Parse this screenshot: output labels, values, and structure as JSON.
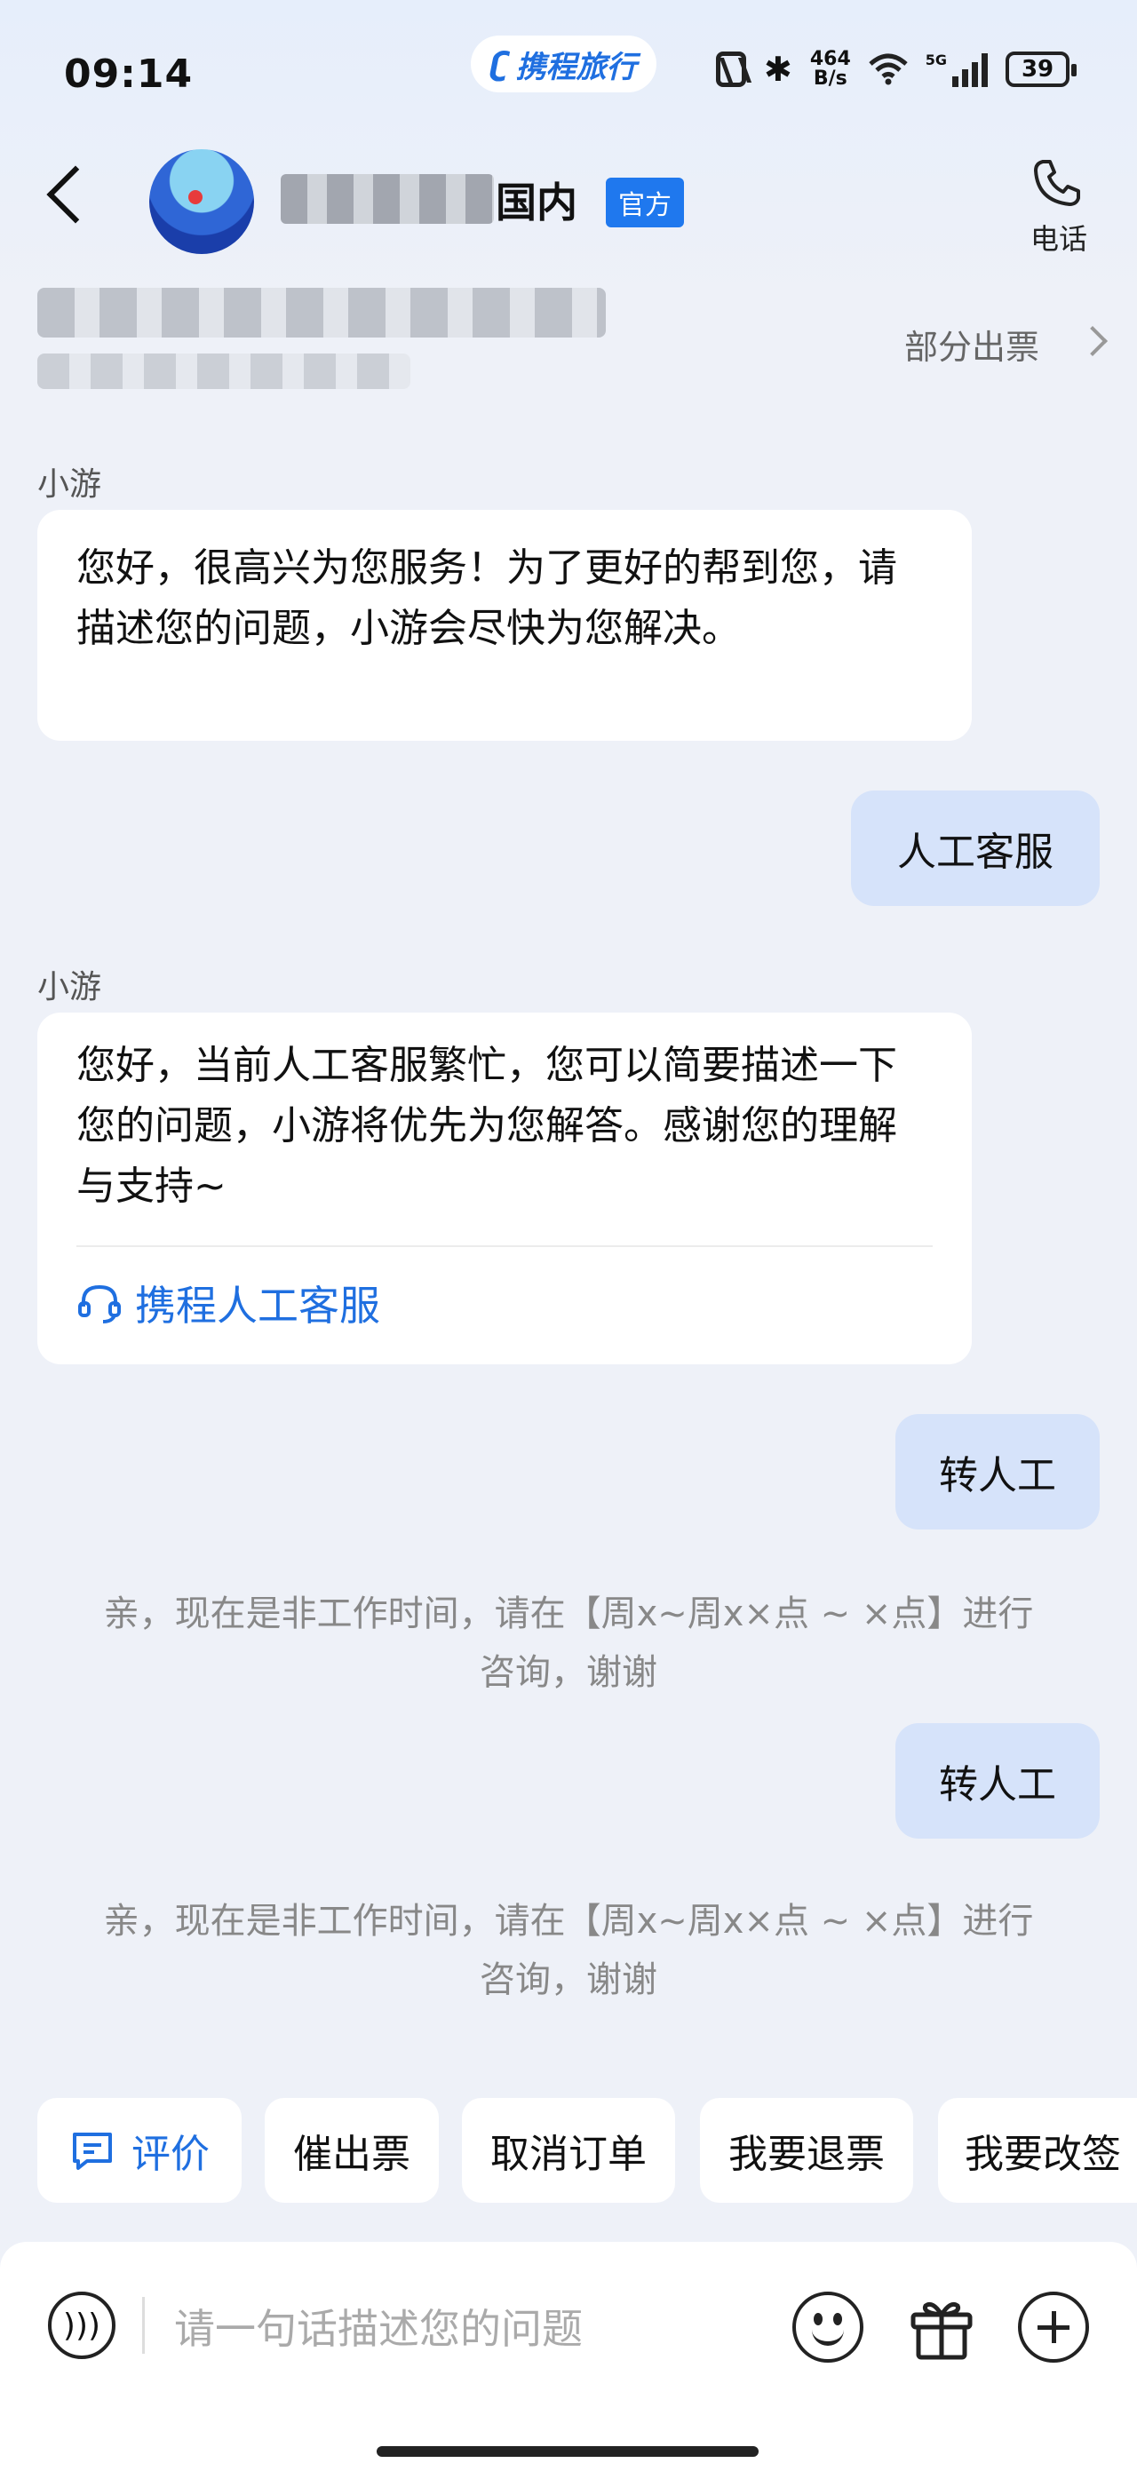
{
  "status_bar": {
    "time": "09:14",
    "brand": "携程旅行",
    "net_speed_value": "464",
    "net_speed_unit": "B/s",
    "network": "5G",
    "battery": "39"
  },
  "header": {
    "title_suffix": "国内",
    "official_badge": "官方",
    "phone_label": "电话",
    "order_status": "部分出票"
  },
  "messages": [
    {
      "type": "in",
      "sender": "小游",
      "text": "您好，很高兴为您服务！为了更好的帮到您，请描述您的问题，小游会尽快为您解决。"
    },
    {
      "type": "out",
      "text": "人工客服"
    },
    {
      "type": "in",
      "sender": "小游",
      "text": "您好，当前人工客服繁忙，您可以简要描述一下您的问题，小游将优先为您解答。感谢您的理解与支持~",
      "link": "携程人工客服"
    },
    {
      "type": "out",
      "text": "转人工"
    },
    {
      "type": "system",
      "text_line1": "亲，现在是非工作时间，请在【周x~周x×点 ~ ×点】进行",
      "text_line2": "咨询，谢谢"
    },
    {
      "type": "out",
      "text": "转人工"
    },
    {
      "type": "system",
      "text_line1": "亲，现在是非工作时间，请在【周x~周x×点 ~ ×点】进行",
      "text_line2": "咨询，谢谢"
    }
  ],
  "quick_actions": [
    "评价",
    "催出票",
    "取消订单",
    "我要退票",
    "我要改签"
  ],
  "input": {
    "placeholder": "请一句话描述您的问题"
  },
  "colors": {
    "accent": "#1f6fe0",
    "outgoing_bubble": "#d6e3fa",
    "background": "#eef1f8"
  }
}
